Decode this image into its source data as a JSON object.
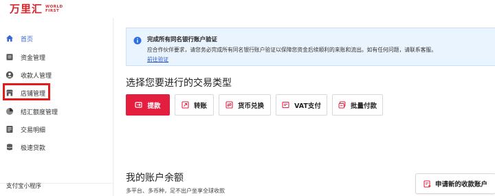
{
  "brand": {
    "name_cn": "万里汇",
    "name_en_line1": "WORLD",
    "name_en_line2": "FIRST"
  },
  "sidebar": {
    "items": [
      {
        "label": "首页",
        "icon": "home-icon",
        "active": true
      },
      {
        "label": "资金管理",
        "icon": "fund-icon"
      },
      {
        "label": "收款人管理",
        "icon": "user-icon"
      },
      {
        "label": "店铺管理",
        "icon": "store-icon"
      },
      {
        "label": "结汇额度管理",
        "icon": "pie-chart-icon"
      },
      {
        "label": "交易明细",
        "icon": "list-icon"
      },
      {
        "label": "极速贷款",
        "icon": "database-icon"
      }
    ],
    "section_label": "支付宝小程序"
  },
  "notice": {
    "title": "完成所有同名银行账户验证",
    "text": "应合作伙伴要求，请您务必完成所有同名银行账户验证以保障您资金后续顺利的来账和流出。如有任何问题，请联系客服。",
    "link": "前往验证"
  },
  "transactions": {
    "title": "选择您要进行的交易类型",
    "buttons": [
      {
        "label": "提款",
        "icon": "withdraw-icon",
        "primary": true
      },
      {
        "label": "转账",
        "icon": "transfer-icon"
      },
      {
        "label": "货币兑换",
        "icon": "exchange-icon"
      },
      {
        "label": "VAT支付",
        "icon": "vat-icon"
      },
      {
        "label": "批量付款",
        "icon": "batch-pay-icon"
      }
    ]
  },
  "balance": {
    "title": "我的账户余额",
    "subtitle": "多平台、多币种，足不出户坐享全球收款",
    "apply_button": "申请新的收款账户"
  },
  "colors": {
    "brand_red": "#e41e3f",
    "highlight_red": "#e21b1b",
    "link_blue": "#2f59c8",
    "active_blue": "#3b64d8",
    "notice_bg": "#eaf4fe"
  }
}
